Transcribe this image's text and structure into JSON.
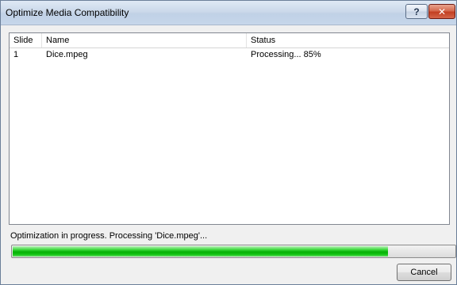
{
  "window": {
    "title": "Optimize Media Compatibility",
    "help_label": "?",
    "close_label": "✕"
  },
  "list": {
    "columns": [
      "Slide",
      "Name",
      "Status"
    ],
    "rows": [
      {
        "slide": "1",
        "name": "Dice.mpeg",
        "status": "Processing... 85%"
      }
    ]
  },
  "status_message": "Optimization in progress. Processing 'Dice.mpeg'...",
  "progress": {
    "fraction": 0.85,
    "color": "#06b006"
  },
  "buttons": {
    "cancel_label": "Cancel"
  }
}
